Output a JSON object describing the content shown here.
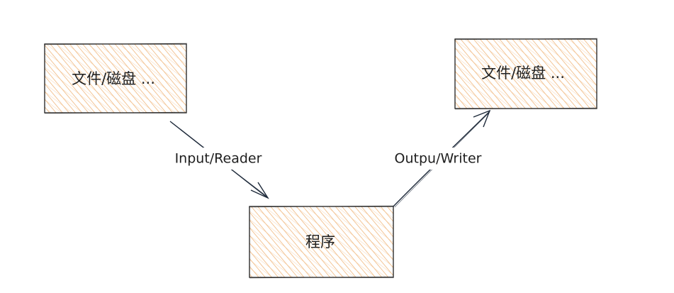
{
  "diagram": {
    "nodes": {
      "source": {
        "label": "文件/磁盘 ..."
      },
      "program": {
        "label": "程序"
      },
      "target": {
        "label": "文件/磁盘 ..."
      }
    },
    "edges": {
      "input": {
        "label": "Input/Reader"
      },
      "output": {
        "label": "Outpu/Writer"
      }
    },
    "colors": {
      "hatch": "#f0b77d",
      "box_stroke": "#1e1e1e",
      "arrow": "#1e2a3a",
      "label_bg": "#ffffff"
    }
  }
}
